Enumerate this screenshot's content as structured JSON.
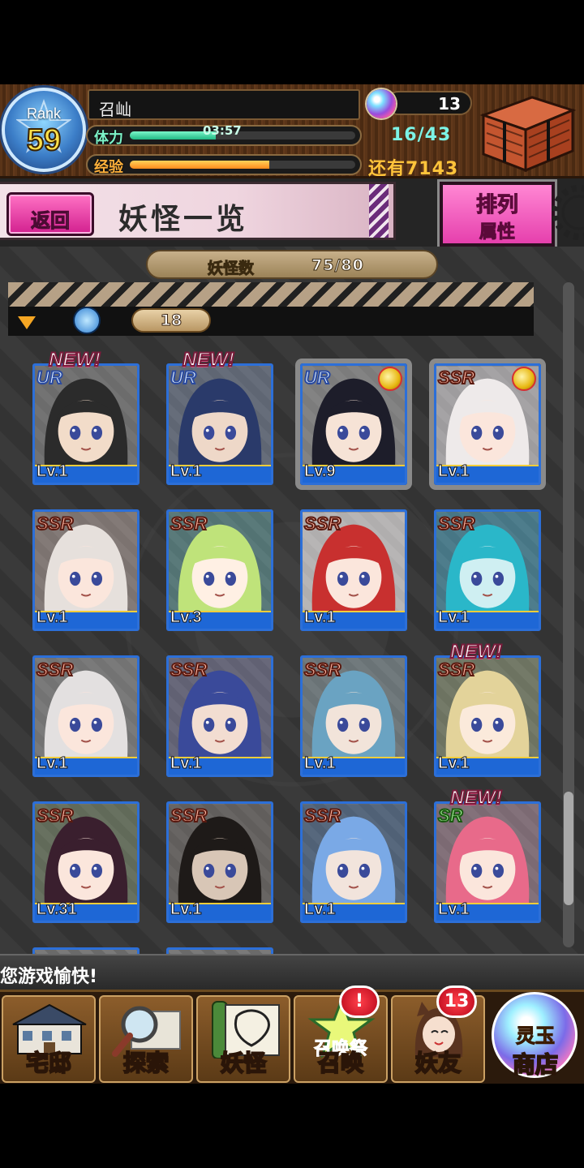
{
  "header": {
    "rank_label": "Rank",
    "rank_value": "59",
    "player_name": "召屾",
    "stamina_label": "体力",
    "stamina_timer": "03:57",
    "stamina_fill_fraction": 0.38,
    "stamina_count": "16/43",
    "exp_label": "经验",
    "exp_fill_fraction": 0.62,
    "exp_remaining": "还有7143",
    "orb_count": "13"
  },
  "subheader": {
    "back_label": "返回",
    "title": "妖怪一览",
    "sort_line1": "排列",
    "sort_line2": "属性"
  },
  "list": {
    "count_label": "妖怪数",
    "count_value": "75/80",
    "filter_value": "18",
    "scroll_position_fraction": 0.77
  },
  "cards": [
    {
      "rarity": "UR",
      "level": "Lv.1",
      "new": true,
      "medal": false,
      "hair": "#2b2b2b",
      "skin": "#f2dcc9",
      "bg": "#6e6e6e"
    },
    {
      "rarity": "UR",
      "level": "Lv.1",
      "new": true,
      "medal": false,
      "hair": "#2a3a6a",
      "skin": "#eed8c8",
      "bg": "#55627a"
    },
    {
      "rarity": "UR",
      "level": "Lv.9",
      "new": false,
      "medal": true,
      "hair": "#1d1d2a",
      "skin": "#f6e3d6",
      "bg": "#8a8a8a"
    },
    {
      "rarity": "SSR",
      "level": "Lv.1",
      "new": false,
      "medal": true,
      "hair": "#eeeaea",
      "skin": "#fbe6dc",
      "bg": "#c9c4c8"
    },
    {
      "rarity": "SSR",
      "level": "Lv.1",
      "new": false,
      "medal": false,
      "hair": "#e6e0dc",
      "skin": "#fbe6dc",
      "bg": "#8a7a74"
    },
    {
      "rarity": "SSR",
      "level": "Lv.3",
      "new": false,
      "medal": false,
      "hair": "#bfe37a",
      "skin": "#fff0e4",
      "bg": "#3f7a7a"
    },
    {
      "rarity": "SSR",
      "level": "Lv.1",
      "new": false,
      "medal": false,
      "hair": "#c8302f",
      "skin": "#fbe6dc",
      "bg": "#e9e6e6"
    },
    {
      "rarity": "SSR",
      "level": "Lv.1",
      "new": false,
      "medal": false,
      "hair": "#2ab7c9",
      "skin": "#cfeff2",
      "bg": "#2a7f9a"
    },
    {
      "rarity": "SSR",
      "level": "Lv.1",
      "new": false,
      "medal": false,
      "hair": "#e3e0e0",
      "skin": "#fbe6dc",
      "bg": "#7a7a7a"
    },
    {
      "rarity": "SSR",
      "level": "Lv.1",
      "new": false,
      "medal": false,
      "hair": "#3a4a9a",
      "skin": "#f2ddd1",
      "bg": "#5a5a7a"
    },
    {
      "rarity": "SSR",
      "level": "Lv.1",
      "new": false,
      "medal": false,
      "hair": "#6aa3c2",
      "skin": "#f2e4da",
      "bg": "#6a7a80"
    },
    {
      "rarity": "SSR",
      "level": "Lv.1",
      "new": true,
      "medal": false,
      "hair": "#e3d39a",
      "skin": "#fbeadb",
      "bg": "#6f7a5a"
    },
    {
      "rarity": "SSR",
      "level": "Lv.31",
      "new": false,
      "medal": false,
      "hair": "#3a1f2e",
      "skin": "#fbe6dc",
      "bg": "#5a6a4a"
    },
    {
      "rarity": "SSR",
      "level": "Lv.1",
      "new": false,
      "medal": false,
      "hair": "#1e1a18",
      "skin": "#d8c6b6",
      "bg": "#5a5450"
    },
    {
      "rarity": "SSR",
      "level": "Lv.1",
      "new": false,
      "medal": false,
      "hair": "#7aa9e6",
      "skin": "#f2e4dc",
      "bg": "#3a5a80"
    },
    {
      "rarity": "SR",
      "level": "Lv.1",
      "new": true,
      "medal": false,
      "hair": "#e86a8a",
      "skin": "#fbe6dc",
      "bg": "#8a6a7a"
    }
  ],
  "badges": {
    "new_label": "NEW!"
  },
  "ticker": {
    "text": "您游戏愉快!"
  },
  "nav": [
    {
      "label": "宅邸",
      "sub": "",
      "badge": ""
    },
    {
      "label": "探索",
      "sub": "",
      "badge": ""
    },
    {
      "label": "妖怪",
      "sub": "",
      "badge": ""
    },
    {
      "label": "召唤",
      "sub": "召唤祭",
      "badge": "!"
    },
    {
      "label": "妖友",
      "sub": "",
      "badge": "13"
    },
    {
      "label": "商店",
      "sub": "灵玉",
      "badge": ""
    }
  ]
}
